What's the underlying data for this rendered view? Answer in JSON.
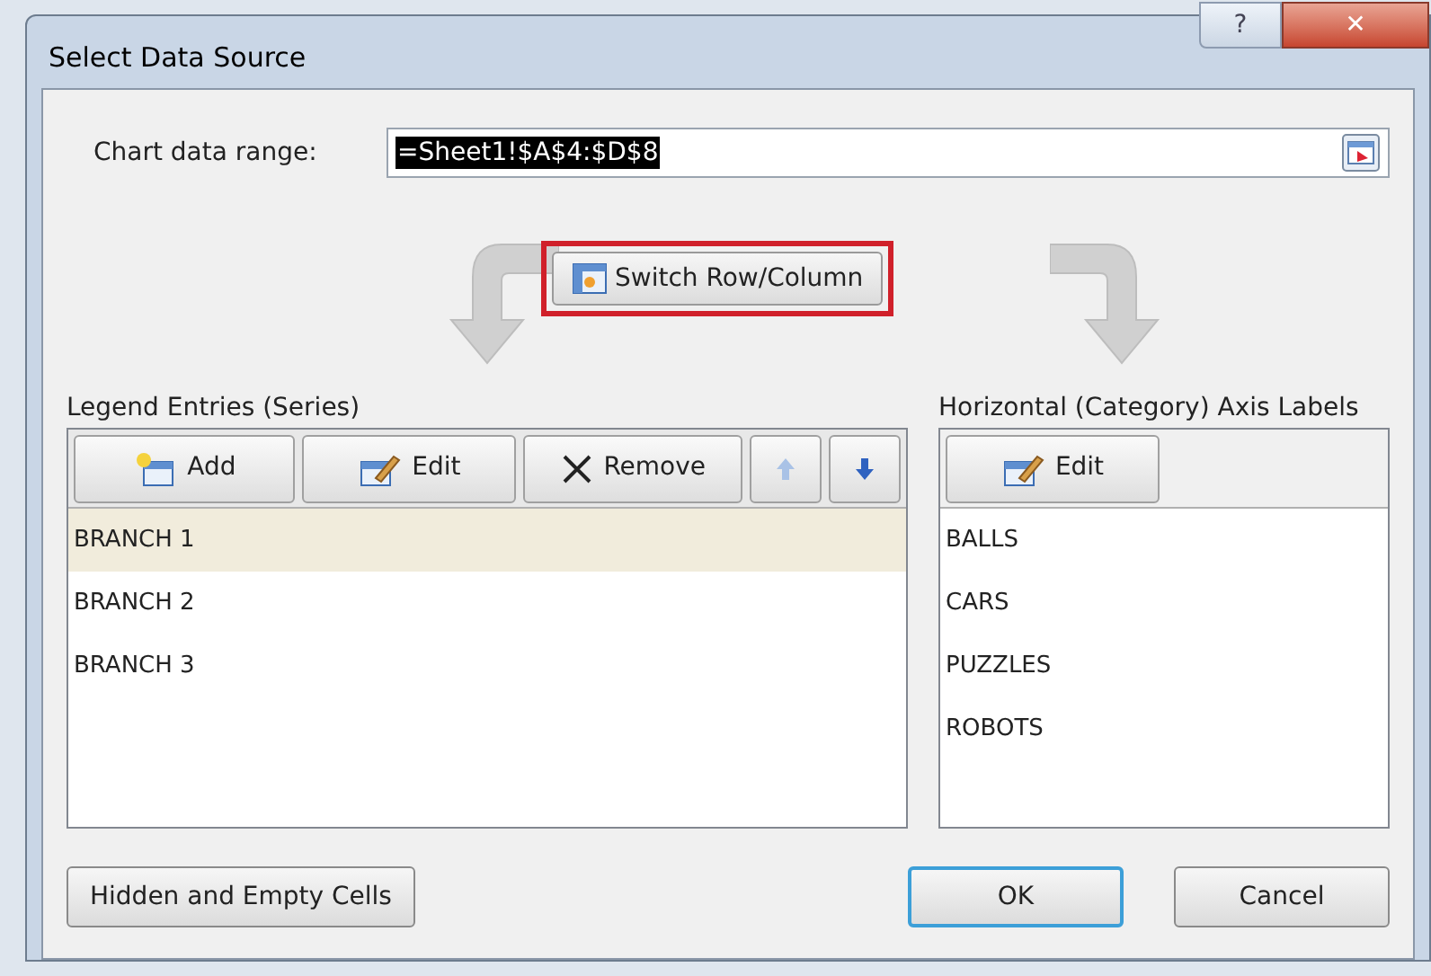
{
  "window": {
    "title": "Select Data Source",
    "buttons": [
      "?",
      "✕"
    ]
  },
  "chart_data_range": {
    "label": "Chart data range:",
    "value": "=Sheet1!$A$4:$D$8"
  },
  "switch_button": {
    "label": "Switch Row/Column",
    "highlighted": true
  },
  "legend_entries": {
    "label": "Legend Entries (Series)",
    "toolbar": [
      {
        "kind": "add",
        "label": "Add"
      },
      {
        "kind": "edit",
        "label": "Edit"
      },
      {
        "kind": "remove",
        "label": "Remove"
      },
      {
        "kind": "up"
      },
      {
        "kind": "down"
      }
    ],
    "items": [
      {
        "label": "BRANCH 1",
        "selected": true
      },
      {
        "label": "BRANCH 2",
        "selected": false
      },
      {
        "label": "BRANCH 3",
        "selected": false
      }
    ]
  },
  "axis_labels": {
    "label": "Horizontal (Category) Axis Labels",
    "toolbar": [
      {
        "kind": "edit",
        "label": "Edit"
      }
    ],
    "items": [
      {
        "label": "BALLS"
      },
      {
        "label": "CARS"
      },
      {
        "label": "PUZZLES"
      },
      {
        "label": "ROBOTS"
      }
    ]
  },
  "buttons": [
    {
      "kind": "left",
      "label": "Hidden and Empty Cells",
      "default": false
    },
    {
      "kind": "right",
      "label": "OK",
      "default": true
    },
    {
      "kind": "right",
      "label": "Cancel",
      "default": false
    }
  ]
}
